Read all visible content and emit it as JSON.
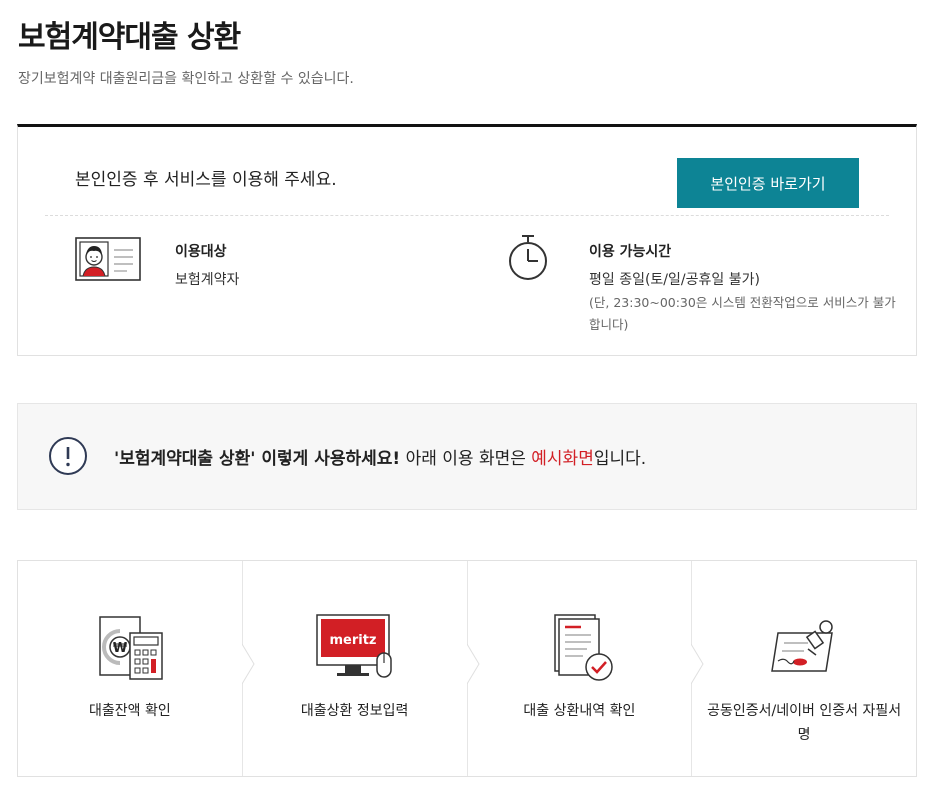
{
  "page": {
    "title": "보험계약대출 상환",
    "description": "장기보험계약 대출원리금을 확인하고 상환할 수 있습니다."
  },
  "auth": {
    "message": "본인인증 후 서비스를 이용해 주세요.",
    "button_label": "본인인증 바로가기",
    "accent_color": "#0d8495",
    "target": {
      "label": "이용대상",
      "value": "보험계약자",
      "icon": "id-card-icon"
    },
    "hours": {
      "label": "이용 가능시간",
      "value": "평일 종일(토/일/공휴일 불가)",
      "note": "(단, 23:30~00:30은 시스템 전환작업으로 서비스가 불가합니다)",
      "icon": "clock-icon"
    }
  },
  "notice": {
    "icon": "exclamation-icon",
    "bold_text": "'보험계약대출 상환' 이렇게 사용하세요!",
    "text_before_red": " 아래 이용 화면은 ",
    "red_text": "예시화면",
    "text_after_red": "입니다.",
    "highlight_color": "#d21f25"
  },
  "steps": [
    {
      "label": "대출잔액 확인",
      "icon": "calculator-icon",
      "symbol": "₩"
    },
    {
      "label": "대출상환 정보입력",
      "icon": "monitor-mouse-icon",
      "screen_text": "meritz"
    },
    {
      "label": "대출 상환내역 확인",
      "icon": "document-check-icon"
    },
    {
      "label": "공동인증서/네이버 인증서 자필서명",
      "icon": "signature-stamp-icon"
    }
  ]
}
